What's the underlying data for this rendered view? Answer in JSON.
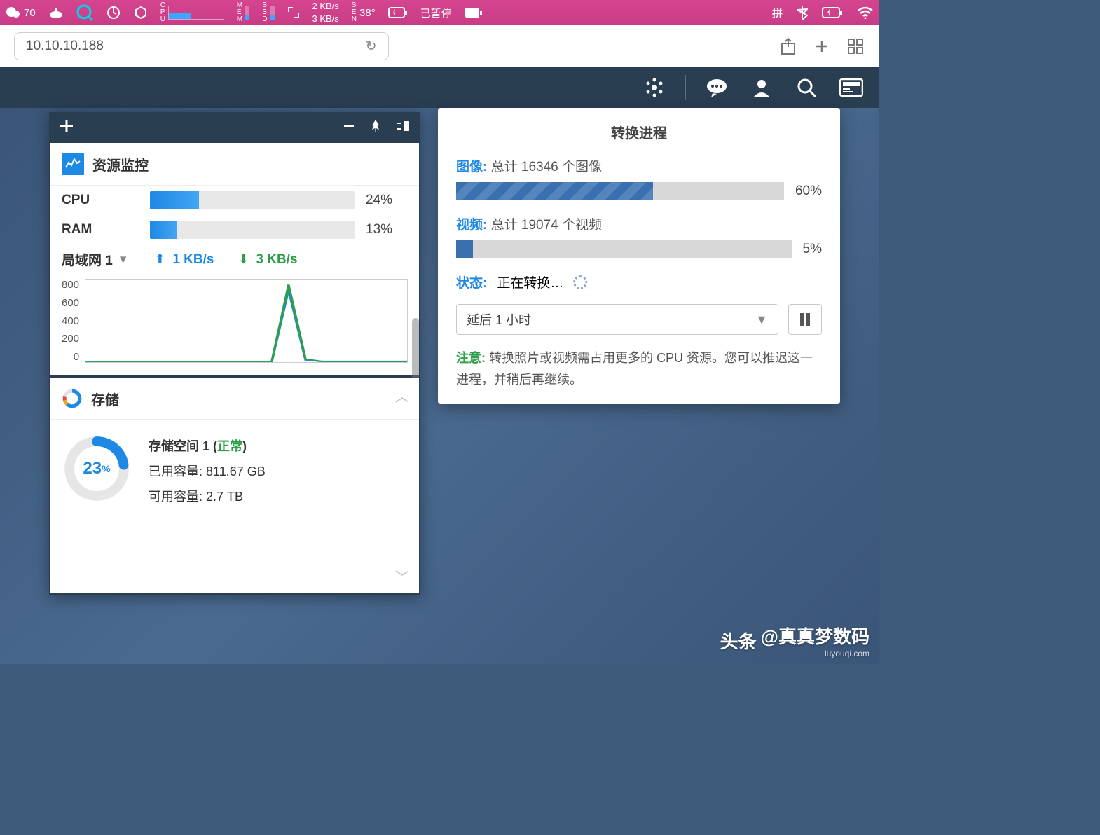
{
  "menubar": {
    "wechat_count": "70",
    "net_up": "2 KB/s",
    "net_down": "3 KB/s",
    "temp": "38°",
    "pause_text": "已暂停",
    "ime": "拼"
  },
  "safari": {
    "url": "10.10.10.188"
  },
  "widget": {
    "monitor_title": "资源监控",
    "cpu_label": "CPU",
    "cpu_pct_text": "24%",
    "cpu_pct": 24,
    "ram_label": "RAM",
    "ram_pct_text": "13%",
    "ram_pct": 13,
    "lan_label": "局域网 1",
    "up_text": "1 KB/s",
    "down_text": "3 KB/s",
    "storage_title": "存储",
    "storage_pct": "23",
    "storage_pct_unit": "%",
    "volume_label": "存储空间 1 (",
    "volume_status": "正常",
    "volume_close": ")",
    "used_label": "已用容量: ",
    "used_val": "811.67 GB",
    "avail_label": "可用容量: ",
    "avail_val": "2.7 TB"
  },
  "chart_data": {
    "type": "line",
    "ylabel": "",
    "xlabel": "",
    "ylim": [
      0,
      800
    ],
    "y_ticks": [
      "800",
      "600",
      "400",
      "200",
      "0"
    ],
    "series": [
      {
        "name": "upload",
        "color": "#1e88e5",
        "values": [
          0,
          0,
          0,
          0,
          0,
          0,
          0,
          0,
          0,
          0,
          0,
          0,
          700,
          20,
          5,
          5,
          5,
          5,
          5,
          5
        ]
      },
      {
        "name": "download",
        "color": "#2e9e4a",
        "values": [
          0,
          0,
          0,
          0,
          0,
          0,
          0,
          0,
          0,
          0,
          0,
          0,
          750,
          30,
          8,
          8,
          8,
          8,
          8,
          8
        ]
      }
    ]
  },
  "popover": {
    "title": "转换进程",
    "image_key": "图像:",
    "image_text": "总计 16346 个图像",
    "image_pct_text": "60%",
    "image_pct": 60,
    "video_key": "视频:",
    "video_text": "总计 19074 个视频",
    "video_pct_text": "5%",
    "video_pct": 5,
    "status_key": "状态:",
    "status_text": "正在转换…",
    "delay_select": "延后 1 小时",
    "note_key": "注意:",
    "note_text": "转换照片或视频需占用更多的 CPU 资源。您可以推迟这一进程，并稍后再继续。"
  },
  "watermark": {
    "brand": "头条",
    "author": "@真真梦数码",
    "sub": "luyouqi.com"
  }
}
